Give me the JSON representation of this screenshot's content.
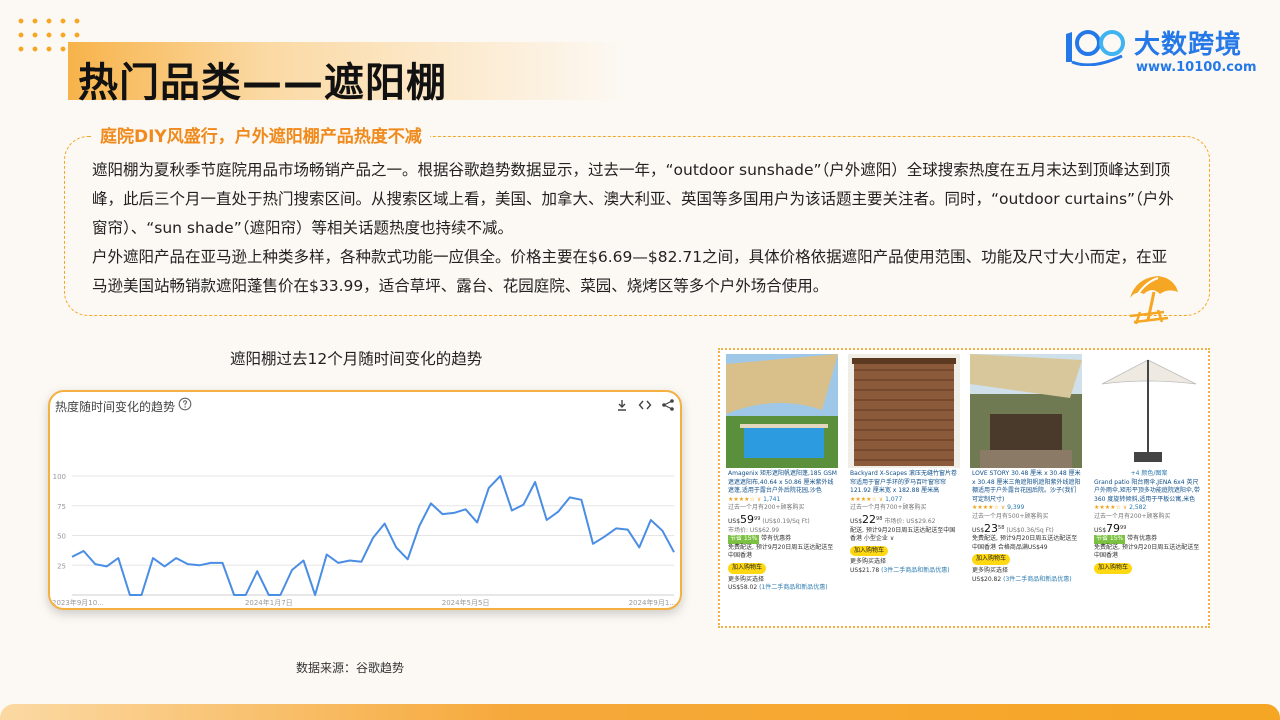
{
  "header": {
    "title": "热门品类——遮阳棚",
    "logo_name": "大数跨境",
    "logo_url": "www.10100.com"
  },
  "info": {
    "heading": "庭院DIY风盛行，户外遮阳棚产品热度不减",
    "paragraph1": "遮阳棚为夏秋季节庭院用品市场畅销产品之一。根据谷歌趋势数据显示，过去一年，“outdoor sunshade”（户外遮阳）全球搜索热度在五月末达到顶峰达到顶峰，此后三个月一直处于热门搜索区间。从搜索区域上看，美国、加拿大、澳大利亚、英国等多国用户为该话题主要关注者。同时，“outdoor curtains”（户外窗帘）、“sun shade”（遮阳帘）等相关话题热度也持续不减。",
    "paragraph2": "户外遮阳产品在亚马逊上种类多样，各种款式功能一应俱全。价格主要在$6.69—$82.71之间，具体价格依据遮阳产品使用范围、功能及尺寸大小而定，在亚马逊美国站畅销款遮阳蓬售价在$33.99，适合草坪、露台、花园庭院、菜园、烧烤区等多个户外场合使用。"
  },
  "chart_section": {
    "caption": "遮阳棚过去12个月随时间变化的趋势",
    "card_title": "热度随时间变化的趋势",
    "source": "数据来源：谷歌趋势"
  },
  "chart_data": {
    "type": "line",
    "title": "热度随时间变化的趋势",
    "xlabel": "",
    "ylabel": "",
    "ylim": [
      0,
      100
    ],
    "y_ticks": [
      25,
      50,
      75,
      100
    ],
    "x_tick_labels": [
      "2023年9月10...",
      "2024年1月7日",
      "2024年5月5日",
      "2024年9月1..."
    ],
    "x_tick_index": [
      0,
      17,
      34,
      51
    ],
    "grid": true,
    "color": "#4a8de4",
    "series": [
      {
        "values": [
          32,
          37,
          26,
          24,
          31,
          0,
          0,
          31,
          24,
          31,
          26,
          25,
          27,
          27,
          0,
          0,
          20,
          0,
          0,
          21,
          29,
          0,
          34,
          27,
          29,
          28,
          48,
          60,
          40,
          30,
          58,
          77,
          68,
          69,
          72,
          61,
          90,
          100,
          71,
          76,
          95,
          63,
          70,
          82,
          80,
          43,
          49,
          56,
          55,
          40,
          63,
          54,
          36
        ]
      }
    ]
  },
  "products": [
    {
      "title": "Amagenix 矩形遮阳帆遮阳蓬,185 GSM 遮遮遮阳布,40.64 x 50.86 厘米紫外线遮蓬,适用于露台户外后院花园,沙色",
      "stars": "★★★★☆ ∨",
      "reviews": "1,741",
      "bought": "过去一个月有200+顾客购买",
      "price_prefix": "US$",
      "price_main": "59",
      "price_cents": "99",
      "price_unit": "(US$0.19/Sq Ft)",
      "list_price": "市场价: US$62.99",
      "deal": "节省 15%",
      "deal_note": "带有优惠券",
      "delivery": "免费配送, 预计9月20日周五送达配送至中国香港",
      "cart": "加入购物车",
      "more": "更多购买选择",
      "more_price": "US$58.02",
      "more_note": "(1件二手商品和新品优惠)"
    },
    {
      "title": "Backyard X-Scapes 滚压无缝竹窗片卷帘适用于窗户手环的罗马百叶窗帘帘 121.92 厘米宽 x 182.88 厘米高",
      "stars": "★★★★☆ ∨",
      "reviews": "1,077",
      "bought": "过去一个月有700+顾客购买",
      "price_prefix": "US$",
      "price_main": "22",
      "price_cents": "98",
      "price_unit": "市场价: US$29.62",
      "list_price": "",
      "deal": "",
      "deal_note": "",
      "delivery": "配送, 预计9月20日周五送达配送至中国香港 小型企业 ∨",
      "cart": "加入购物车",
      "more": "更多购买选择",
      "more_price": "US$21.78",
      "more_note": "(3件二手商品和新品优惠)"
    },
    {
      "title": "LOVE STORY 30.48 厘米 x 30.48 厘米 x 30.48 厘米三角遮阳帆遮阳紫外线遮阳棚适用于户外露台花园后院。沙子(我们可定制尺寸)",
      "stars": "★★★★☆ ∨",
      "reviews": "9,399",
      "bought": "过去一个月有500+顾客购买",
      "price_prefix": "US$",
      "price_main": "23",
      "price_cents": "58",
      "price_unit": "(US$0.36/Sq Ft)",
      "list_price": "",
      "deal": "",
      "deal_note": "",
      "delivery": "免费配送, 预计9月20日周五送达配送至中国香港 合格商品满US$49",
      "cart": "加入购物车",
      "more": "更多购买选择",
      "more_price": "US$20.82",
      "more_note": "(3件二手商品和新品优惠)"
    },
    {
      "title": "Grand patio 阳台雨伞,JENA 6x4 英尺户外雨伞,矩形平顶多功能庭院遮阳伞,带 360 度旋转倾斜,适用于平板公寓,米色",
      "stars": "★★★★☆ ∨",
      "reviews": "2,582",
      "bought": "过去一个月有200+顾客购买",
      "price_prefix": "US$",
      "price_main": "79",
      "price_cents": "99",
      "price_unit": "",
      "list_price": "",
      "deal": "节省 15%",
      "deal_note": "带有优惠券",
      "delivery": "免费配送, 预计9月20日周五送达配送至中国香港",
      "cart": "加入购物车",
      "more": "",
      "more_price": "",
      "more_note": "",
      "variants": "+4 颜色/图案"
    }
  ]
}
